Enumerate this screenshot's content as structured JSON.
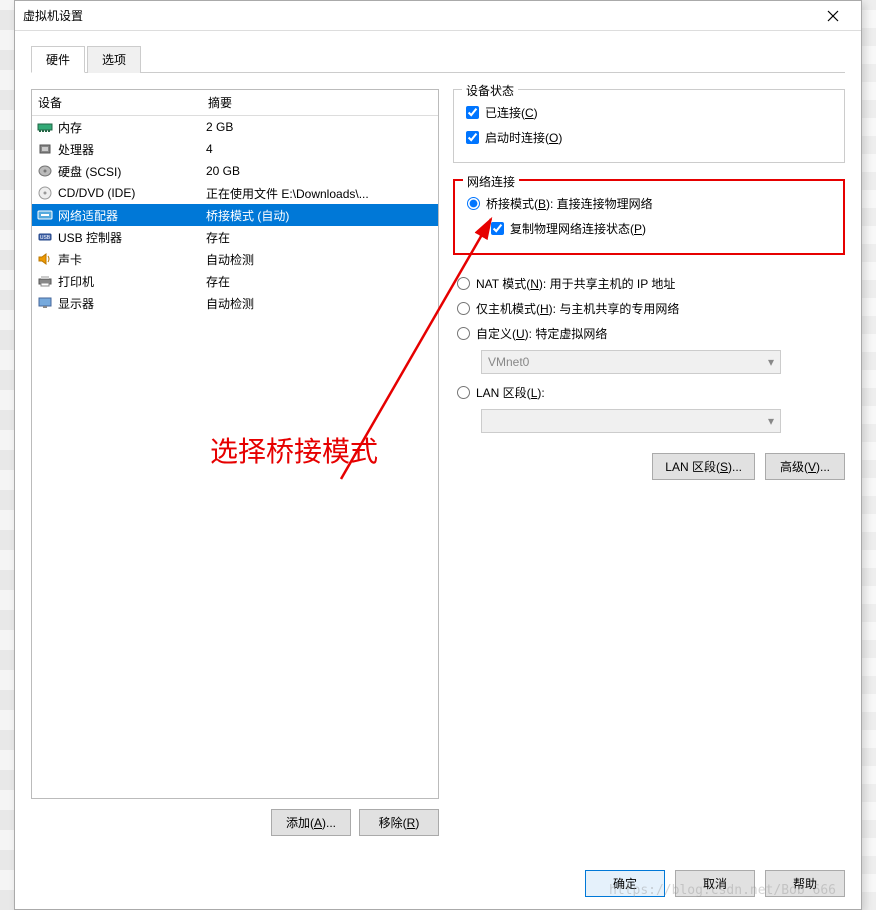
{
  "window": {
    "title": "虚拟机设置"
  },
  "tabs": {
    "hardware": "硬件",
    "options": "选项"
  },
  "list": {
    "header_device": "设备",
    "header_summary": "摘要",
    "rows": [
      {
        "icon": "memory",
        "name": "内存",
        "summary": "2 GB"
      },
      {
        "icon": "cpu",
        "name": "处理器",
        "summary": "4"
      },
      {
        "icon": "disk",
        "name": "硬盘 (SCSI)",
        "summary": "20 GB"
      },
      {
        "icon": "cd",
        "name": "CD/DVD (IDE)",
        "summary": "正在使用文件 E:\\Downloads\\..."
      },
      {
        "icon": "net",
        "name": "网络适配器",
        "summary": "桥接模式 (自动)"
      },
      {
        "icon": "usb",
        "name": "USB 控制器",
        "summary": "存在"
      },
      {
        "icon": "sound",
        "name": "声卡",
        "summary": "自动检测"
      },
      {
        "icon": "printer",
        "name": "打印机",
        "summary": "存在"
      },
      {
        "icon": "display",
        "name": "显示器",
        "summary": "自动检测"
      }
    ]
  },
  "left_buttons": {
    "add": "添加(A)...",
    "remove": "移除(R)"
  },
  "device_state": {
    "title": "设备状态",
    "connected": "已连接(C)",
    "connect_at_poweron": "启动时连接(O)"
  },
  "net": {
    "title": "网络连接",
    "bridged": "桥接模式(B): 直接连接物理网络",
    "replicate": "复制物理网络连接状态(P)",
    "nat": "NAT 模式(N): 用于共享主机的 IP 地址",
    "hostonly": "仅主机模式(H): 与主机共享的专用网络",
    "custom": "自定义(U): 特定虚拟网络",
    "custom_value": "VMnet0",
    "lan": "LAN 区段(L):",
    "lan_value": ""
  },
  "right_buttons": {
    "lan_segments": "LAN 区段(S)...",
    "advanced": "高级(V)..."
  },
  "footer": {
    "ok": "确定",
    "cancel": "取消",
    "help": "帮助"
  },
  "annotation": "选择桥接模式",
  "watermark": "https://blog.csdn.net/Bob_666"
}
